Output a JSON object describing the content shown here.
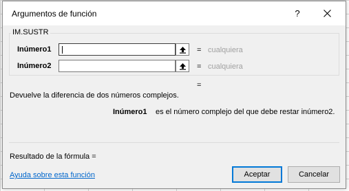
{
  "dialog": {
    "title": "Argumentos de función",
    "help_glyph": "?",
    "function_name": "IM.SUSTR"
  },
  "arguments": [
    {
      "label": "Inúmero1",
      "value": "",
      "equals": "=",
      "result": "cualquiera",
      "focused": true
    },
    {
      "label": "Inúmero2",
      "value": "",
      "equals": "=",
      "result": "cualquiera",
      "focused": false
    }
  ],
  "formula_equals": "=",
  "description": "Devuelve la diferencia de dos números complejos.",
  "argument_help": {
    "name": "Inúmero1",
    "text": "es el número complejo del que debe restar inúmero2."
  },
  "result_label": "Resultado de la fórmula =",
  "help_link": "Ayuda sobre esta función",
  "buttons": {
    "ok": "Aceptar",
    "cancel": "Cancelar"
  },
  "icons": {
    "close": "close-icon",
    "collapse": "collapse-dialog-icon"
  },
  "colors": {
    "primary_border": "#0078d7",
    "link": "#0066cc",
    "muted": "#a0a0a0"
  }
}
